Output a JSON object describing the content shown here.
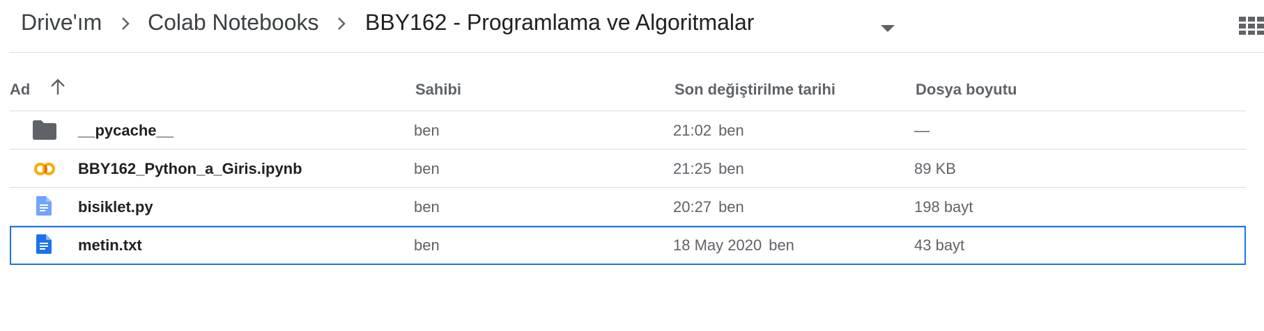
{
  "breadcrumb": {
    "items": [
      "Drive'ım",
      "Colab Notebooks"
    ],
    "current": "BBY162 - Programlama ve Algoritmalar"
  },
  "columns": {
    "name": "Ad",
    "owner": "Sahibi",
    "modified": "Son değiştirilme tarihi",
    "size": "Dosya boyutu"
  },
  "colors": {
    "selection": "#1a73e8",
    "folder": "#5f6368",
    "doc": "#4285f4",
    "colab": "#f9ab00"
  },
  "rows": [
    {
      "icon": "folder-icon",
      "name": "__pycache__",
      "owner": "ben",
      "modified_time": "21:02",
      "modified_by": "ben",
      "size": "—"
    },
    {
      "icon": "colab-icon",
      "name": "BBY162_Python_a_Giris.ipynb",
      "owner": "ben",
      "modified_time": "21:25",
      "modified_by": "ben",
      "size": "89 KB"
    },
    {
      "icon": "doc-icon",
      "name": "bisiklet.py",
      "owner": "ben",
      "modified_time": "20:27",
      "modified_by": "ben",
      "size": "198 bayt"
    },
    {
      "icon": "doc-icon",
      "name": "metin.txt",
      "owner": "ben",
      "modified_time": "18 May 2020",
      "modified_by": "ben",
      "size": "43 bayt",
      "selected": true
    }
  ]
}
